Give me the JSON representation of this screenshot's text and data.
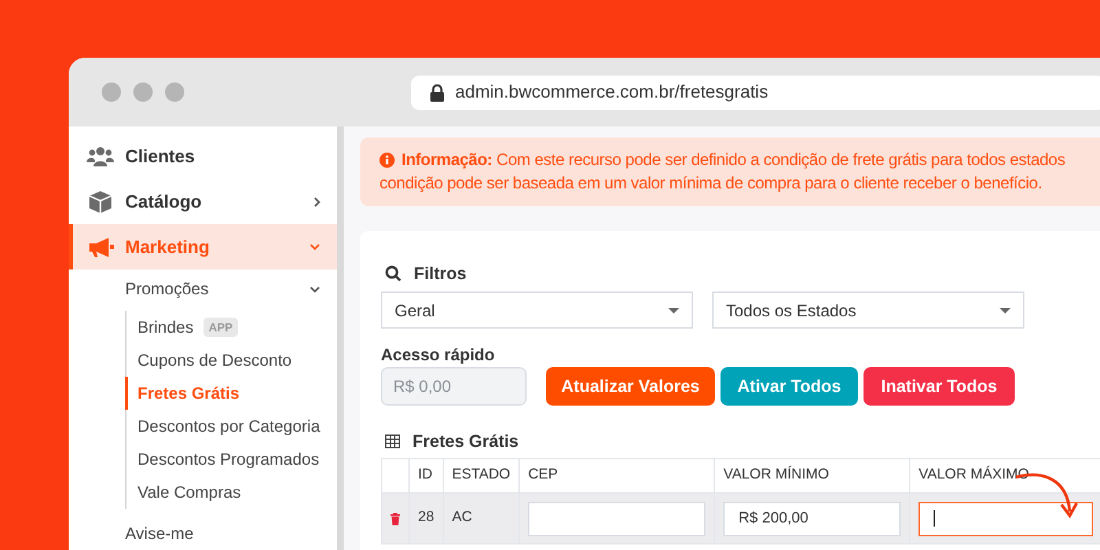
{
  "browser": {
    "url": "admin.bwcommerce.com.br/fretesgratis"
  },
  "sidebar": {
    "items": [
      {
        "label": "Clientes",
        "selected": false
      },
      {
        "label": "Catálogo",
        "selected": false,
        "expanded": false
      },
      {
        "label": "Marketing",
        "selected": true,
        "expanded": true,
        "children": [
          {
            "label": "Promoções",
            "expanded": true,
            "children": [
              {
                "label": "Brindes",
                "badge": "APP",
                "selected": false
              },
              {
                "label": "Cupons de Desconto",
                "selected": false
              },
              {
                "label": "Fretes Grátis",
                "selected": true
              },
              {
                "label": "Descontos por Categoria",
                "selected": false
              },
              {
                "label": "Descontos Programados",
                "selected": false
              },
              {
                "label": "Vale Compras",
                "selected": false
              }
            ]
          },
          {
            "label": "Avise-me"
          }
        ]
      }
    ]
  },
  "info": {
    "lines": [
      "**Informação:** Com este recurso pode ser definido a condição de frete grátis para todos estados",
      "condição pode ser baseada em um valor mínima de compra para o cliente receber o benefício."
    ]
  },
  "filters": {
    "title": "Filtros",
    "selects": [
      "Geral",
      "Todos os Estados"
    ]
  },
  "quick_access": {
    "label": "Acesso rápido",
    "placeholder": "R$ 0,00",
    "buttons": [
      {
        "label": "Atualizar Valores",
        "kind": "primary"
      },
      {
        "label": "Ativar Todos",
        "kind": "info"
      },
      {
        "label": "Inativar Todos",
        "kind": "danger"
      }
    ]
  },
  "table": {
    "title": "Fretes Grátis",
    "columns": [
      "",
      "ID",
      "ESTADO",
      "CEP",
      "VALOR MÍNIMO",
      "VALOR MÁXIMO"
    ],
    "rows": [
      {
        "highlighted": true,
        "cells": [
          {
            "kind": "delete"
          },
          {
            "kind": "text",
            "text": "28"
          },
          {
            "kind": "text",
            "text": "AC"
          },
          {
            "kind": "input",
            "focused": false
          },
          {
            "kind": "input",
            "value": "R$ 200,00",
            "focused": false
          },
          {
            "kind": "input",
            "focused": true
          }
        ]
      }
    ]
  }
}
